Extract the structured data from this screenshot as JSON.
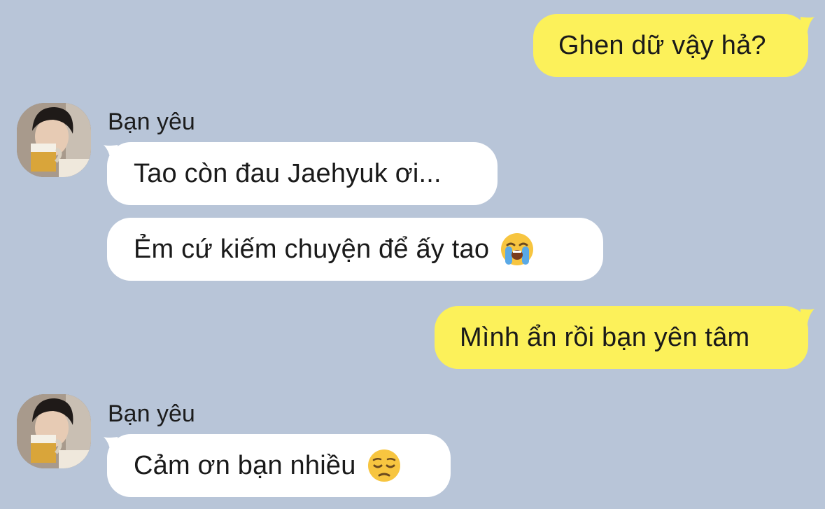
{
  "messages": [
    {
      "side": "me",
      "text": "Ghen dữ vậy hả?"
    },
    {
      "side": "them",
      "sender": "Bạn yêu",
      "text": "Tao còn đau Jaehyuk ơi..."
    },
    {
      "side": "them",
      "text": "Ẻm cứ kiếm chuyện để ấy tao",
      "emoji": "loudly-crying-face-emoji"
    },
    {
      "side": "me",
      "text": "Mình ẩn rồi bạn yên tâm"
    },
    {
      "side": "them",
      "sender": "Bạn yêu",
      "text": "Cảm ơn bạn nhiều",
      "emoji": "pensive-face-emoji"
    }
  ],
  "colors": {
    "background": "#b8c5d8",
    "my_bubble": "#fcf15a",
    "their_bubble": "#ffffff"
  }
}
